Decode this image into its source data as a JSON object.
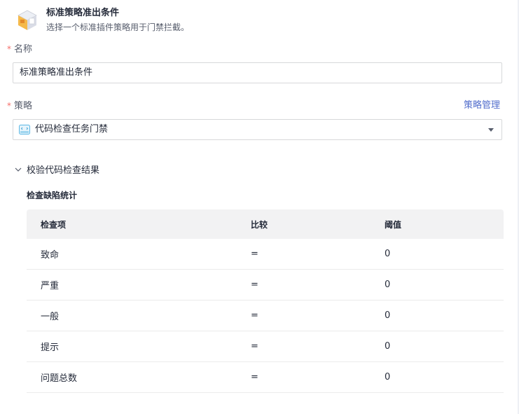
{
  "header": {
    "title": "标准策略准出条件",
    "subtitle": "选择一个标准插件策略用于门禁拦截。"
  },
  "name_field": {
    "label": "名称",
    "required_mark": "*",
    "value": "标准策略准出条件"
  },
  "policy_field": {
    "label": "策略",
    "required_mark": "*",
    "manage_link": "策略管理",
    "selected": "代码检查任务门禁"
  },
  "section": {
    "title": "校验代码检查结果",
    "subtitle": "检查缺陷统计"
  },
  "table": {
    "headers": [
      "检查项",
      "比较",
      "阈值"
    ],
    "rows": [
      [
        "致命",
        "=",
        "0"
      ],
      [
        "严重",
        "=",
        "0"
      ],
      [
        "一般",
        "=",
        "0"
      ],
      [
        "提示",
        "=",
        "0"
      ],
      [
        "问题总数",
        "=",
        "0"
      ]
    ]
  },
  "colors": {
    "accent_link": "#526ecc",
    "required": "#f66f6a",
    "table_header_bg": "#f2f2f3"
  }
}
